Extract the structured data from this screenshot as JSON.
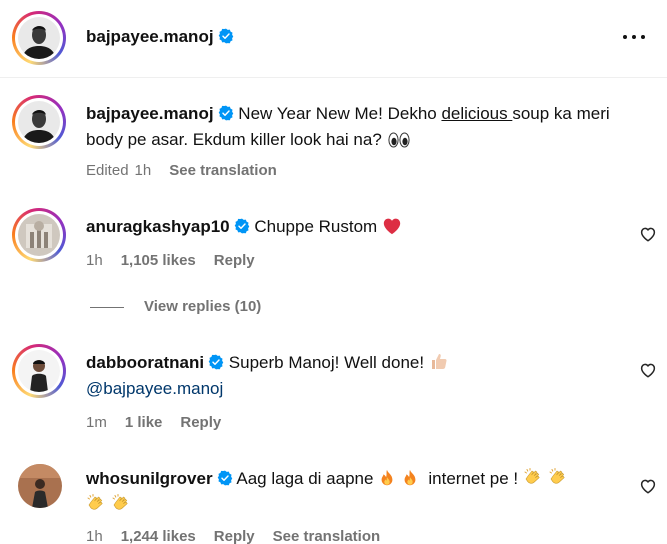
{
  "header": {
    "username": "bajpayee.manoj"
  },
  "caption": {
    "username": "bajpayee.manoj",
    "text_part1": "New Year New Me! Dekho ",
    "text_underlined": "delicious ",
    "text_part2": "soup ka meri body pe asar. Ekdum killer look hai na?",
    "edited": "Edited",
    "time": "1h",
    "see_translation": "See translation"
  },
  "comments": [
    {
      "username": "anuragkashyap10",
      "text": "Chuppe Rustom",
      "time": "1h",
      "likes": "1,105 likes",
      "reply": "Reply",
      "view_replies": "View replies (10)"
    },
    {
      "username": "dabbooratnani",
      "text": "Superb Manoj! Well done!",
      "mention": "@bajpayee.manoj",
      "time": "1m",
      "likes": "1 like",
      "reply": "Reply"
    },
    {
      "username": "whosunilgrover",
      "text_part1": "Aag laga di aapne",
      "text_part2": "internet pe !",
      "time": "1h",
      "likes": "1,244 likes",
      "reply": "Reply",
      "see_translation": "See translation"
    }
  ],
  "colors": {
    "verified": "#0095f6",
    "link": "#00376b",
    "meta": "#737373",
    "heart": "#ed4956"
  },
  "icons": [
    "verified-badge-icon",
    "more-options-icon",
    "heart-outline-icon",
    "eyes-emoji-icon",
    "red-heart-emoji-icon",
    "thumbs-up-emoji-icon",
    "fire-emoji-icon",
    "clapping-hands-emoji-icon"
  ]
}
